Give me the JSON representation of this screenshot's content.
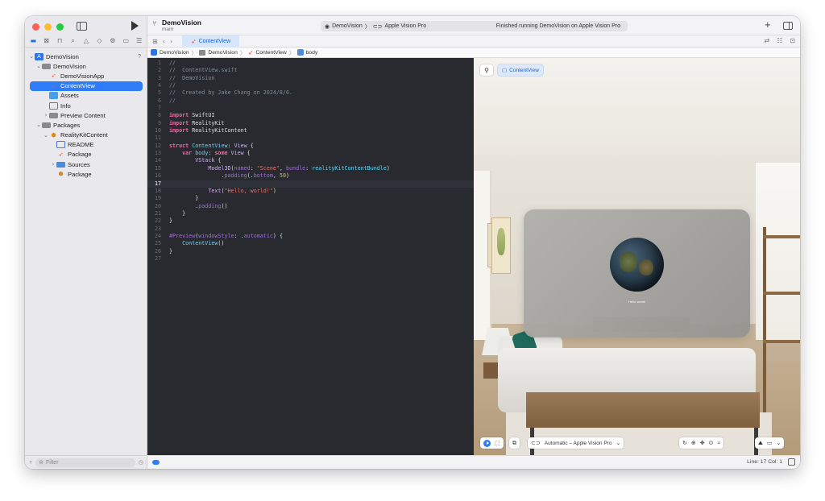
{
  "toolbar": {
    "project_name": "DemoVision",
    "branch": "main",
    "scheme_name": "DemoVision",
    "scheme_chevron": "〉",
    "destination": "Apple Vision Pro",
    "status": "Finished running DemoVision on Apple Vision Pro",
    "plus": "+"
  },
  "tab": {
    "label": "ContentView"
  },
  "breadcrumb": [
    "DemoVision",
    "DemoVision",
    "ContentView",
    "body"
  ],
  "sidebar": {
    "items": [
      {
        "label": "DemoVision",
        "indent": 0,
        "chev": "⌄",
        "icon": "project-icon",
        "badge": "?"
      },
      {
        "label": "DemoVision",
        "indent": 1,
        "chev": "⌄",
        "icon": "folder-icon"
      },
      {
        "label": "DemoVisionApp",
        "indent": 2,
        "chev": "",
        "icon": "swift-file-icon"
      },
      {
        "label": "ContentView",
        "indent": 2,
        "chev": "",
        "icon": "swift-file-icon",
        "selected": true
      },
      {
        "label": "Assets",
        "indent": 2,
        "chev": "",
        "icon": "assets-icon"
      },
      {
        "label": "Info",
        "indent": 2,
        "chev": "",
        "icon": "info-plist-icon"
      },
      {
        "label": "Preview Content",
        "indent": 2,
        "chev": "›",
        "icon": "folder-icon"
      },
      {
        "label": "Packages",
        "indent": 1,
        "chev": "⌄",
        "icon": "folder-icon"
      },
      {
        "label": "RealityKitContent",
        "indent": 2,
        "chev": "⌄",
        "icon": "package-icon"
      },
      {
        "label": "README",
        "indent": 3,
        "chev": "",
        "icon": "book-icon"
      },
      {
        "label": "Package",
        "indent": 3,
        "chev": "",
        "icon": "swift-file-icon"
      },
      {
        "label": "Sources",
        "indent": 3,
        "chev": "›",
        "icon": "folder-blue-icon"
      },
      {
        "label": "Package",
        "indent": 3,
        "chev": "",
        "icon": "package-icon"
      }
    ],
    "filter_placeholder": "Filter"
  },
  "code_lines": [
    [
      [
        "c-comment",
        "//"
      ]
    ],
    [
      [
        "c-comment",
        "//  ContentView.swift"
      ]
    ],
    [
      [
        "c-comment",
        "//  DemoVision"
      ]
    ],
    [
      [
        "c-comment",
        "//"
      ]
    ],
    [
      [
        "c-comment",
        "//  Created by Jake Chang on 2024/8/6."
      ]
    ],
    [
      [
        "c-comment",
        "//"
      ]
    ],
    [],
    [
      [
        "c-kw",
        "import"
      ],
      [
        "c-plain",
        " SwiftUI"
      ]
    ],
    [
      [
        "c-kw",
        "import"
      ],
      [
        "c-plain",
        " RealityKit"
      ]
    ],
    [
      [
        "c-kw",
        "import"
      ],
      [
        "c-plain",
        " RealityKitContent"
      ]
    ],
    [],
    [
      [
        "c-kw",
        "struct"
      ],
      [
        "c-plain",
        " "
      ],
      [
        "c-type",
        "ContentView"
      ],
      [
        "c-plain",
        ": "
      ],
      [
        "c-type2",
        "View"
      ],
      [
        "c-plain",
        " {"
      ]
    ],
    [
      [
        "c-plain",
        "    "
      ],
      [
        "c-kw",
        "var"
      ],
      [
        "c-plain",
        " "
      ],
      [
        "c-type",
        "body"
      ],
      [
        "c-plain",
        ": "
      ],
      [
        "c-kw",
        "some"
      ],
      [
        "c-plain",
        " "
      ],
      [
        "c-type2",
        "View"
      ],
      [
        "c-plain",
        " {"
      ]
    ],
    [
      [
        "c-plain",
        "        "
      ],
      [
        "c-type2",
        "VStack"
      ],
      [
        "c-plain",
        " {"
      ]
    ],
    [
      [
        "c-plain",
        "            "
      ],
      [
        "c-type2",
        "Model3D"
      ],
      [
        "c-plain",
        "("
      ],
      [
        "c-fn",
        "named"
      ],
      [
        "c-plain",
        ": "
      ],
      [
        "c-str",
        "\"Scene\""
      ],
      [
        "c-plain",
        ", "
      ],
      [
        "c-fn",
        "bundle"
      ],
      [
        "c-plain",
        ": "
      ],
      [
        "c-type",
        "realityKitContentBundle"
      ],
      [
        "c-plain",
        ")"
      ]
    ],
    [
      [
        "c-plain",
        "                ."
      ],
      [
        "c-fn",
        "padding"
      ],
      [
        "c-plain",
        "(."
      ],
      [
        "c-fn",
        "bottom"
      ],
      [
        "c-plain",
        ", "
      ],
      [
        "c-num",
        "50"
      ],
      [
        "c-plain",
        ")"
      ]
    ],
    [],
    [
      [
        "c-plain",
        "            "
      ],
      [
        "c-type2",
        "Text"
      ],
      [
        "c-plain",
        "("
      ],
      [
        "c-str",
        "\"Hello, world!\""
      ],
      [
        "c-plain",
        ")"
      ]
    ],
    [
      [
        "c-plain",
        "        }"
      ]
    ],
    [
      [
        "c-plain",
        "        ."
      ],
      [
        "c-fn",
        "padding"
      ],
      [
        "c-plain",
        "()"
      ]
    ],
    [
      [
        "c-plain",
        "    }"
      ]
    ],
    [
      [
        "c-plain",
        "}"
      ]
    ],
    [],
    [
      [
        "c-fn",
        "#Preview"
      ],
      [
        "c-plain",
        "("
      ],
      [
        "c-fn",
        "windowStyle"
      ],
      [
        "c-plain",
        ": ."
      ],
      [
        "c-fn",
        "automatic"
      ],
      [
        "c-plain",
        ") {"
      ]
    ],
    [
      [
        "c-plain",
        "    "
      ],
      [
        "c-type",
        "ContentView"
      ],
      [
        "c-plain",
        "()"
      ]
    ],
    [
      [
        "c-plain",
        "}"
      ]
    ],
    []
  ],
  "current_line": 17,
  "canvas": {
    "preview_button_label": "ContentView",
    "hello_text": "Hello, world!",
    "device_label": "Automatic – Apple Vision Pro"
  },
  "status": {
    "line_col": "Line: 17  Col: 1"
  },
  "colors": {
    "accent": "#2f7df6",
    "editor_bg": "#292a30",
    "keyword": "#fc5fa3",
    "string": "#fc6a5d",
    "comment": "#7f8c98"
  }
}
